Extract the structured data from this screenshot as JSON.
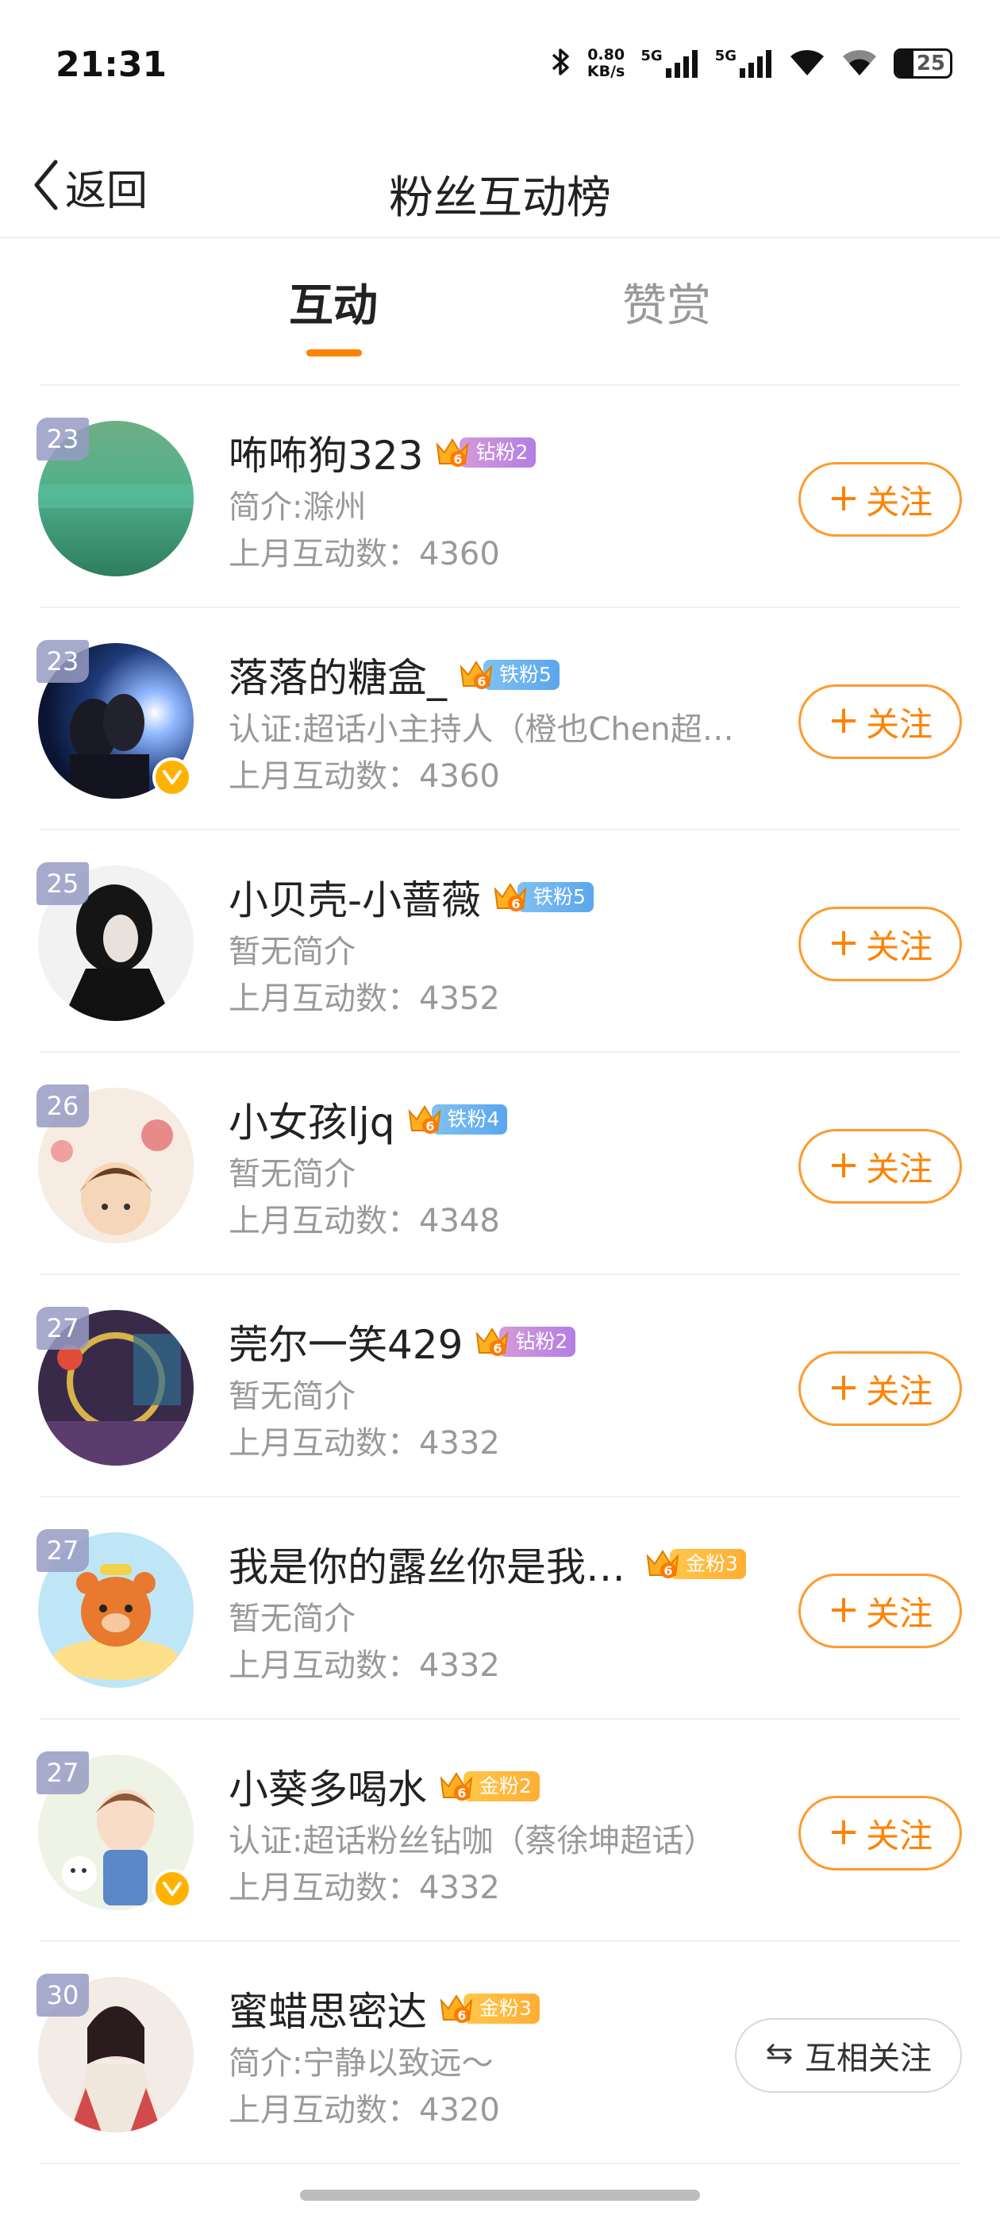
{
  "status_bar": {
    "time": "21:31",
    "net_speed_value": "0.80",
    "net_speed_unit": "KB/s",
    "signal_label_1": "5G",
    "signal_label_2": "5G",
    "battery_level": "25",
    "icons": [
      "bluetooth-icon",
      "signal-5g-icon",
      "signal-5g-icon",
      "wifi-icon",
      "wifi-icon",
      "battery-icon"
    ]
  },
  "header": {
    "back_label": "返回",
    "title": "粉丝互动榜"
  },
  "tabs": [
    {
      "label": "互动",
      "active": true
    },
    {
      "label": "赞赏",
      "active": false
    }
  ],
  "colors": {
    "accent": "#ff8200",
    "text_secondary": "#999999",
    "badge_diamond": "#b27fe3",
    "badge_iron": "#5aa6ee",
    "badge_gold": "#ffae33"
  },
  "fans": [
    {
      "rank": "23",
      "name": "咘咘狗323",
      "badge_level": "6",
      "badge_label": "钻粉2",
      "badge_type": "diamond",
      "desc": "简介:滁州",
      "count": "上月互动数：4360",
      "verified": false,
      "action": "关注"
    },
    {
      "rank": "23",
      "name": "落落的糖盒_",
      "badge_level": "6",
      "badge_label": "铁粉5",
      "badge_type": "iron",
      "desc": "认证:超话小主持人（橙也Chen超…",
      "count": "上月互动数：4360",
      "verified": true,
      "action": "关注"
    },
    {
      "rank": "25",
      "name": "小贝壳-小蔷薇",
      "badge_level": "6",
      "badge_label": "铁粉5",
      "badge_type": "iron",
      "desc": "暂无简介",
      "count": "上月互动数：4352",
      "verified": false,
      "action": "关注"
    },
    {
      "rank": "26",
      "name": "小女孩ljq",
      "badge_level": "6",
      "badge_label": "铁粉4",
      "badge_type": "iron",
      "desc": "暂无简介",
      "count": "上月互动数：4348",
      "verified": false,
      "action": "关注"
    },
    {
      "rank": "27",
      "name": "莞尔一笑429",
      "badge_level": "6",
      "badge_label": "钻粉2",
      "badge_type": "diamond",
      "desc": "暂无简介",
      "count": "上月互动数：4332",
      "verified": false,
      "action": "关注"
    },
    {
      "rank": "27",
      "name": "我是你的露丝你是我…",
      "badge_level": "6",
      "badge_label": "金粉3",
      "badge_type": "gold",
      "desc": "暂无简介",
      "count": "上月互动数：4332",
      "verified": false,
      "action": "关注"
    },
    {
      "rank": "27",
      "name": "小葵多喝水",
      "badge_level": "6",
      "badge_label": "金粉2",
      "badge_type": "gold",
      "desc": "认证:超话粉丝钻咖（蔡徐坤超话）",
      "count": "上月互动数：4332",
      "verified": true,
      "action": "关注"
    },
    {
      "rank": "30",
      "name": "蜜蜡思密达",
      "badge_level": "6",
      "badge_label": "金粉3",
      "badge_type": "gold",
      "desc": "简介:宁静以致远～",
      "count": "上月互动数：4320",
      "verified": false,
      "action": "互相关注"
    }
  ]
}
